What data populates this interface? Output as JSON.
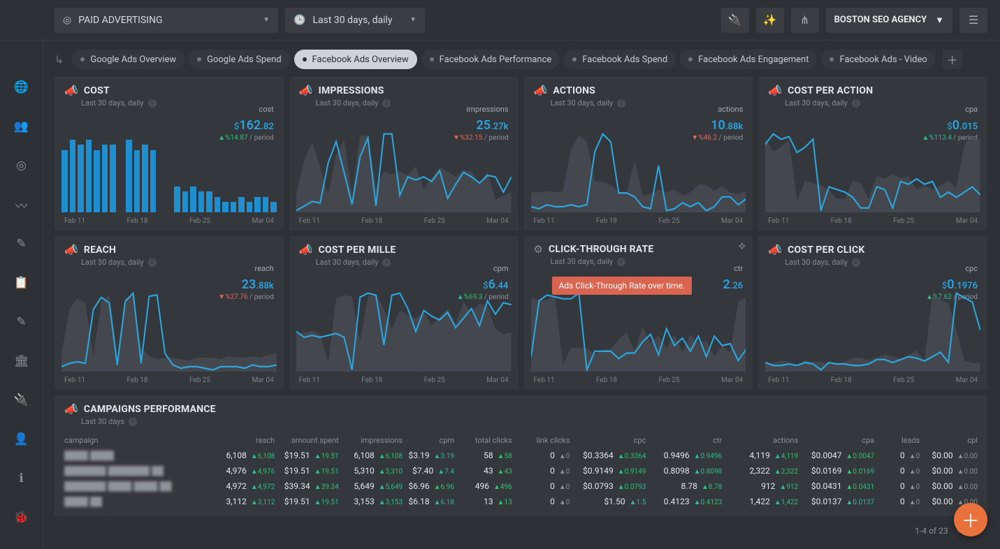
{
  "topbar": {
    "scope": "PAID ADVERTISING",
    "date_range": "Last 30 days, daily",
    "agency": "BOSTON SEO AGENCY"
  },
  "tabs": [
    {
      "label": "Google Ads Overview",
      "active": false
    },
    {
      "label": "Google Ads Spend",
      "active": false
    },
    {
      "label": "Facebook Ads Overview",
      "active": true
    },
    {
      "label": "Facebook Ads Performance",
      "active": false
    },
    {
      "label": "Facebook Ads Spend",
      "active": false
    },
    {
      "label": "Facebook Ads Engagement",
      "active": false
    },
    {
      "label": "Facebook Ads - Video",
      "active": false
    }
  ],
  "x_ticks": [
    "Feb 11",
    "Feb 18",
    "Feb 25",
    "Mar 04"
  ],
  "cards": [
    {
      "id": "cost",
      "title": "COST",
      "subtitle": "Last 30 days, daily",
      "metric_label": "cost",
      "prefix": "$",
      "value": "162",
      "dec": ".82",
      "delta": "%14.87",
      "delta_dir": "up",
      "period": "/ period",
      "type": "bar"
    },
    {
      "id": "impr",
      "title": "IMPRESSIONS",
      "subtitle": "Last 30 days, daily",
      "metric_label": "impressions",
      "prefix": "",
      "value": "25",
      "dec": ".27k",
      "delta": "%32.15",
      "delta_dir": "down",
      "period": "/ period",
      "type": "line"
    },
    {
      "id": "act",
      "title": "ACTIONS",
      "subtitle": "Last 30 days, daily",
      "metric_label": "actions",
      "prefix": "",
      "value": "10",
      "dec": ".88k",
      "delta": "%46.2",
      "delta_dir": "down",
      "period": "/ period",
      "type": "line"
    },
    {
      "id": "cpa",
      "title": "COST PER ACTION",
      "subtitle": "Last 30 days, daily",
      "metric_label": "cpa",
      "prefix": "$",
      "value": "0",
      "dec": ".015",
      "delta": "%113.4",
      "delta_dir": "up",
      "period": "/ period",
      "type": "line"
    },
    {
      "id": "reach",
      "title": "REACH",
      "subtitle": "Last 30 days, daily",
      "metric_label": "reach",
      "prefix": "",
      "value": "23",
      "dec": ".88k",
      "delta": "%27.76",
      "delta_dir": "down",
      "period": "/ period",
      "type": "line"
    },
    {
      "id": "cpm",
      "title": "COST PER MILLE",
      "subtitle": "Last 30 days, daily",
      "metric_label": "cpm",
      "prefix": "$",
      "value": "6",
      "dec": ".44",
      "delta": "%69.3",
      "delta_dir": "up",
      "period": "/ period",
      "type": "line"
    },
    {
      "id": "ctr",
      "title": "CLICK-THROUGH RATE",
      "subtitle": "Last 30 days, daily",
      "metric_label": "ctr",
      "prefix": "",
      "value": "2",
      "dec": ".26",
      "delta": "",
      "delta_dir": "",
      "period": "",
      "type": "line",
      "tooltip": "Ads Click-Through Rate over time.",
      "gear": true,
      "move": true
    },
    {
      "id": "cpc",
      "title": "COST PER CLICK",
      "subtitle": "Last 30 days, daily",
      "metric_label": "cpc",
      "prefix": "$",
      "value": "0",
      "dec": ".1976",
      "delta": "%7.62",
      "delta_dir": "up",
      "period": "/ period",
      "type": "line"
    }
  ],
  "chart_data": [
    {
      "type": "bar",
      "card": "cost",
      "title": "COST",
      "ylabel": "cost",
      "categories_ticks": [
        "Feb 11",
        "Feb 18",
        "Feb 25",
        "Mar 04"
      ],
      "values": [
        12,
        14,
        13,
        14,
        12,
        13,
        13,
        0,
        14,
        12,
        13,
        12,
        0,
        0,
        5,
        4,
        5,
        4,
        4,
        3,
        2,
        2,
        3,
        2,
        3,
        3,
        2
      ],
      "ylim": [
        0,
        16
      ]
    },
    {
      "type": "line",
      "card": "impr",
      "title": "IMPRESSIONS",
      "ylabel": "impressions",
      "x_ticks": [
        "Feb 11",
        "Feb 18",
        "Feb 25",
        "Mar 04"
      ],
      "values": [
        200,
        260,
        320,
        300,
        820,
        1100,
        700,
        280,
        900,
        1150,
        260,
        1200,
        1200,
        400,
        640,
        600,
        640,
        580,
        720,
        360,
        540,
        700,
        640,
        560,
        660,
        640,
        440,
        640
      ]
    },
    {
      "type": "line",
      "card": "act",
      "title": "ACTIONS",
      "ylabel": "actions",
      "x_ticks": [
        "Feb 11",
        "Feb 18",
        "Feb 25",
        "Mar 04"
      ],
      "values": [
        260,
        240,
        280,
        260,
        260,
        280,
        260,
        280,
        820,
        1000,
        920,
        400,
        400,
        360,
        260,
        240,
        680,
        220,
        240,
        300,
        260,
        300,
        220,
        260,
        360,
        360,
        280,
        340
      ]
    },
    {
      "type": "line",
      "card": "cpa",
      "title": "COST PER ACTION",
      "ylabel": "cpa",
      "x_ticks": [
        "Feb 11",
        "Feb 18",
        "Feb 25",
        "Mar 04"
      ],
      "values": [
        0.03,
        0.034,
        0.032,
        0.033,
        0.027,
        0.029,
        0.032,
        0.005,
        0.014,
        0.013,
        0.012,
        0.01,
        0.006,
        0.006,
        0.014,
        0.013,
        0.006,
        0.016,
        0.015,
        0.017,
        0.015,
        0.016,
        0.01,
        0.012,
        0.01,
        0.012,
        0.014,
        0.011
      ]
    },
    {
      "type": "line",
      "card": "reach",
      "title": "REACH",
      "ylabel": "reach",
      "x_ticks": [
        "Feb 11",
        "Feb 18",
        "Feb 25",
        "Mar 04"
      ],
      "values": [
        200,
        240,
        260,
        240,
        900,
        1050,
        980,
        220,
        1000,
        1100,
        240,
        1060,
        1080,
        360,
        220,
        180,
        200,
        200,
        180,
        160,
        200,
        200,
        200,
        180,
        220,
        200,
        200,
        220
      ]
    },
    {
      "type": "line",
      "card": "cpm",
      "title": "COST PER MILLE",
      "ylabel": "cpm",
      "x_ticks": [
        "Feb 11",
        "Feb 18",
        "Feb 25",
        "Mar 04"
      ],
      "values": [
        5.0,
        4.4,
        4.6,
        4.4,
        4.6,
        4.8,
        4.4,
        1.0,
        8.6,
        9.0,
        8.8,
        3.6,
        8.8,
        9.0,
        7.4,
        5.0,
        7.2,
        6.6,
        6.2,
        7.0,
        5.4,
        6.4,
        7.4,
        5.6,
        8.2,
        6.8,
        8.0,
        7.8
      ]
    },
    {
      "type": "line",
      "card": "ctr",
      "title": "CLICK-THROUGH RATE",
      "ylabel": "ctr",
      "x_ticks": [
        "Feb 11",
        "Feb 18",
        "Feb 25",
        "Mar 04"
      ],
      "values": [
        1.1,
        4.1,
        4.4,
        4.3,
        4.2,
        4.2,
        4.5,
        0.4,
        1.4,
        1.4,
        1.4,
        1.0,
        1.3,
        1.3,
        1.9,
        2.3,
        1.2,
        2.6,
        1.7,
        2.1,
        1.4,
        2.2,
        1.1,
        2.2,
        1.7,
        1.8,
        0.9,
        1.5
      ]
    },
    {
      "type": "line",
      "card": "cpc",
      "title": "COST PER CLICK",
      "ylabel": "cpc",
      "x_ticks": [
        "Feb 11",
        "Feb 18",
        "Feb 25",
        "Mar 04"
      ],
      "values": [
        0.08,
        0.06,
        0.06,
        0.07,
        0.06,
        0.08,
        0.07,
        0.03,
        0.08,
        0.07,
        0.07,
        0.06,
        0.06,
        0.07,
        0.1,
        0.1,
        0.08,
        0.1,
        0.12,
        0.11,
        0.09,
        0.12,
        0.15,
        0.08,
        0.55,
        0.52,
        0.49,
        0.3
      ]
    }
  ],
  "campaigns": {
    "title": "CAMPAIGNS PERFORMANCE",
    "subtitle": "Last 30 days",
    "columns": [
      "campaign",
      "reach",
      "amount spent",
      "impressions",
      "cpm",
      "total clicks",
      "link clicks",
      "cpc",
      "ctr",
      "actions",
      "cpa",
      "leads",
      "cpl"
    ],
    "rows": [
      {
        "name": "████ ████",
        "reach": [
          "6,108",
          "6,108"
        ],
        "spent": [
          "$19.51",
          "19.51"
        ],
        "impr": [
          "6,108",
          "6,108"
        ],
        "cpm": [
          "$3.19",
          "3.19"
        ],
        "tclicks": [
          "58",
          "58"
        ],
        "lclicks": [
          "0",
          "0"
        ],
        "cpc": [
          "$0.3364",
          "0.3364"
        ],
        "ctr": [
          "0.9496",
          "0.9496"
        ],
        "actions": [
          "4,119",
          "4,119"
        ],
        "cpa": [
          "$0.0047",
          "0.0047"
        ],
        "leads": [
          "0",
          "0"
        ],
        "cpl": [
          "$0.00",
          "0.00"
        ]
      },
      {
        "name": "███████ ███████ ██",
        "reach": [
          "4,976",
          "4,976"
        ],
        "spent": [
          "$19.51",
          "19.51"
        ],
        "impr": [
          "5,310",
          "5,310"
        ],
        "cpm": [
          "$7.40",
          "7.4"
        ],
        "tclicks": [
          "43",
          "43"
        ],
        "lclicks": [
          "0",
          "0"
        ],
        "cpc": [
          "$0.9149",
          "0.9149"
        ],
        "ctr": [
          "0.8098",
          "0.8098"
        ],
        "actions": [
          "2,322",
          "2,322"
        ],
        "cpa": [
          "$0.0169",
          "0.0169"
        ],
        "leads": [
          "0",
          "0"
        ],
        "cpl": [
          "$0.00",
          "0.00"
        ]
      },
      {
        "name": "███████ ████ ████ ██",
        "reach": [
          "4,972",
          "4,972"
        ],
        "spent": [
          "$39.34",
          "39.34"
        ],
        "impr": [
          "5,649",
          "5,649"
        ],
        "cpm": [
          "$6.96",
          "6.96"
        ],
        "tclicks": [
          "496",
          "496"
        ],
        "lclicks": [
          "0",
          "0"
        ],
        "cpc": [
          "$0.0793",
          "0.0793"
        ],
        "ctr": [
          "8.78",
          "8.78"
        ],
        "actions": [
          "912",
          "912"
        ],
        "cpa": [
          "$0.0431",
          "0.0431"
        ],
        "leads": [
          "0",
          "0"
        ],
        "cpl": [
          "$0.00",
          "0.00"
        ]
      },
      {
        "name": "████ ██",
        "reach": [
          "3,112",
          "3,112"
        ],
        "spent": [
          "$19.51",
          "19.51"
        ],
        "impr": [
          "3,153",
          "3,153"
        ],
        "cpm": [
          "$6.18",
          "6.18"
        ],
        "tclicks": [
          "13",
          "13"
        ],
        "lclicks": [
          "0",
          "0"
        ],
        "cpc": [
          "$1.50",
          "1.5"
        ],
        "ctr": [
          "0.4123",
          "0.4123"
        ],
        "actions": [
          "1,422",
          "1,422"
        ],
        "cpa": [
          "$0.0137",
          "0.0137"
        ],
        "leads": [
          "0",
          "0"
        ],
        "cpl": [
          "$0.00",
          "0.00"
        ]
      }
    ],
    "pager": "1-4 of 23"
  }
}
